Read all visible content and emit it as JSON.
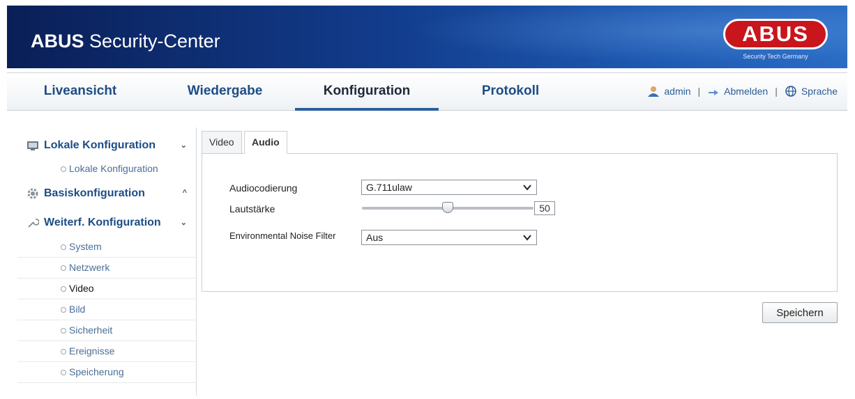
{
  "header": {
    "brand_bold": "ABUS",
    "brand_rest": " Security-Center",
    "logo_text": "ABUS",
    "logo_tagline": "Security Tech Germany",
    "colors": {
      "banner": "#123c8c",
      "logo_red": "#c9151c"
    }
  },
  "nav": {
    "tabs": [
      {
        "label": "Liveansicht"
      },
      {
        "label": "Wiedergabe"
      },
      {
        "label": "Konfiguration"
      },
      {
        "label": "Protokoll"
      }
    ],
    "active_tab": "Konfiguration",
    "user": {
      "name": "admin",
      "logout": "Abmelden",
      "language": "Sprache",
      "sep1": "|",
      "sep2": "|"
    },
    "icons": {
      "user": "user-icon",
      "logout": "logout-icon",
      "language": "globe-icon"
    }
  },
  "sidebar": {
    "groups": [
      {
        "label": "Lokale Konfiguration",
        "icon": "local-config-icon",
        "chevron": "⌄"
      },
      {
        "label": "Basiskonfiguration",
        "icon": "gear-icon",
        "chevron": "^"
      },
      {
        "label": "Weiterf. Konfiguration",
        "icon": "wrench-icon",
        "chevron": "⌄"
      }
    ],
    "local_items": [
      {
        "label": "Lokale Konfiguration"
      }
    ],
    "advanced_items": [
      {
        "label": "System"
      },
      {
        "label": "Netzwerk"
      },
      {
        "label": "Video"
      },
      {
        "label": "Bild"
      },
      {
        "label": "Sicherheit"
      },
      {
        "label": "Ereignisse"
      },
      {
        "label": "Speicherung"
      }
    ],
    "active_item": "Video"
  },
  "content": {
    "tabs": [
      {
        "label": "Video"
      },
      {
        "label": "Audio"
      }
    ],
    "active_tab": "Audio",
    "fields": {
      "audio_encoding": {
        "label": "Audiocodierung",
        "value": "G.711ulaw"
      },
      "volume": {
        "label": "Lautstärke",
        "value": "50",
        "level_percent": 50
      },
      "noise_filter": {
        "label": "Environmental Noise Filter",
        "value": "Aus"
      }
    },
    "save_label": "Speichern"
  }
}
